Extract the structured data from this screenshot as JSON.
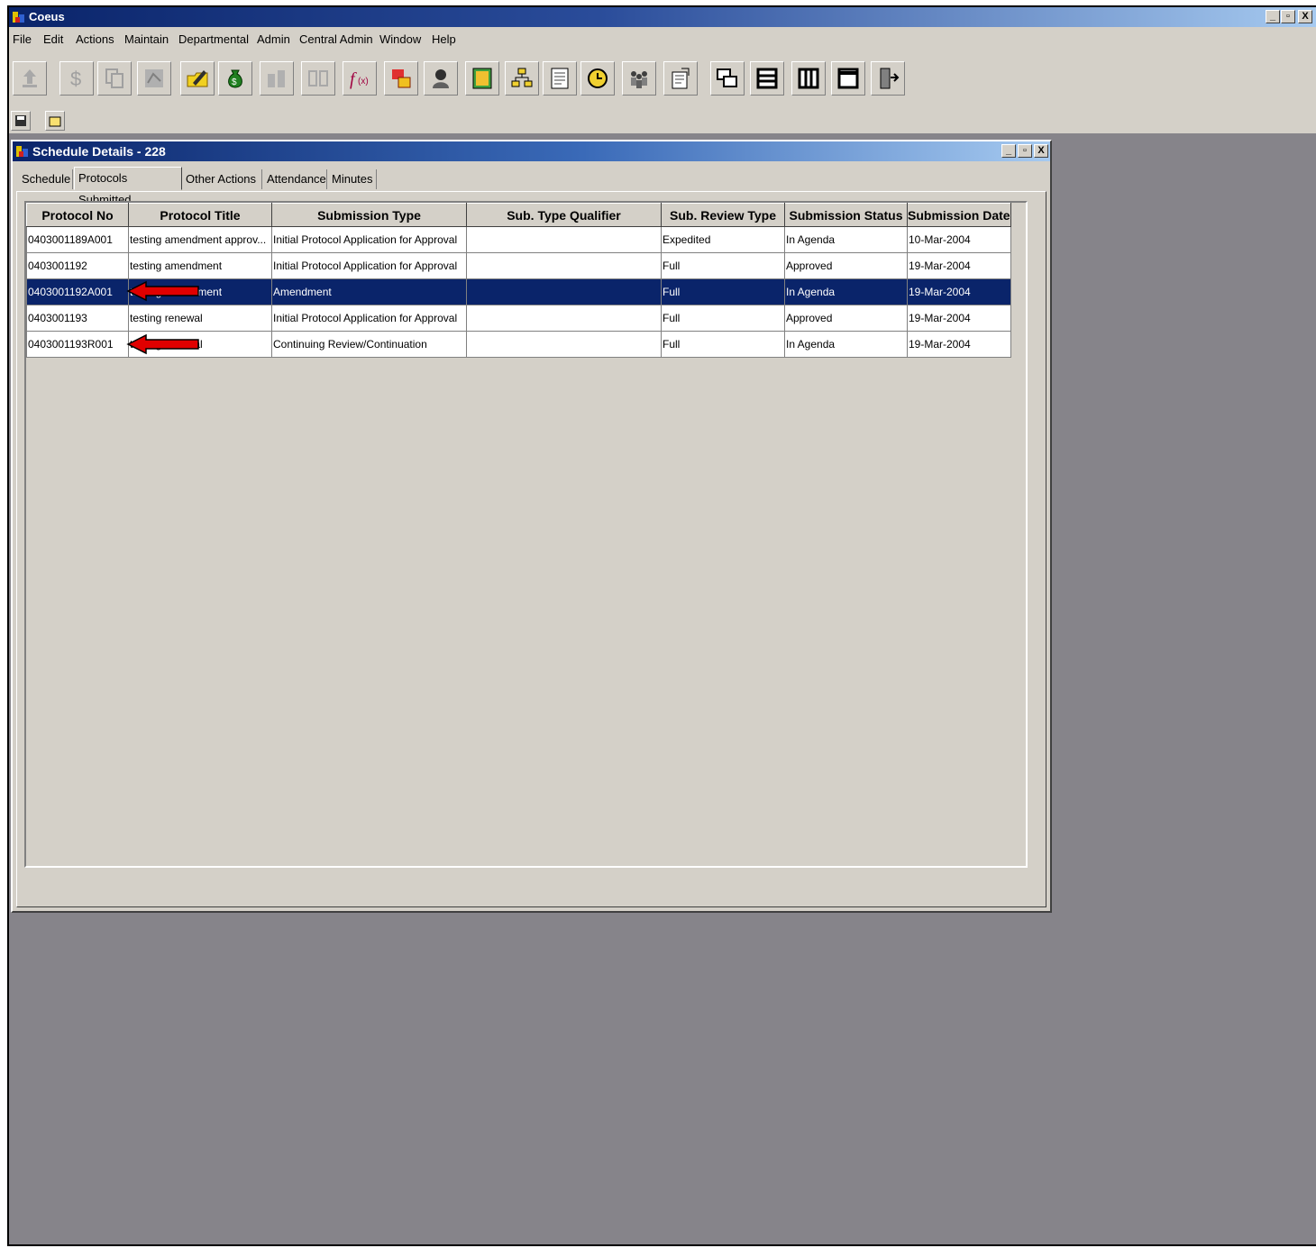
{
  "app": {
    "title": "Coeus"
  },
  "menu": [
    "File",
    "Edit",
    "Actions",
    "Maintain",
    "Departmental",
    "Admin",
    "Central Admin",
    "Window",
    "Help"
  ],
  "window_controls": {
    "minimize": "_",
    "restore": "▫",
    "close": "X"
  },
  "toolbar_icons": [
    "upload-icon",
    "dollar-icon",
    "copy-document-icon",
    "tree-icon",
    "edit-folder-icon",
    "money-bag-icon",
    "people-icon",
    "grid-icon",
    "function-icon",
    "swap-icon",
    "inspector-icon",
    "calculator-icon",
    "hierarchy-icon",
    "notepad-icon",
    "clock-icon",
    "group-icon",
    "report-icon",
    "cascade-windows-icon",
    "tile-horizontal-icon",
    "tile-vertical-icon",
    "maximize-window-icon",
    "exit-icon"
  ],
  "toolbar2_icons": [
    "save-icon",
    "open-icon"
  ],
  "child_window": {
    "title": "Schedule Details - 228",
    "tabs": [
      "Schedule",
      "Protocols Submitted",
      "Other Actions",
      "Attendance",
      "Minutes"
    ],
    "active_tab": "Protocols Submitted"
  },
  "table": {
    "columns": [
      "Protocol No",
      "Protocol Title",
      "Submission Type",
      "Sub. Type Qualifier",
      "Sub. Review Type",
      "Submission Status",
      "Submission Date"
    ],
    "rows": [
      [
        "0403001189A001",
        "testing amendment approv...",
        "Initial Protocol Application for Approval",
        "",
        "Expedited",
        "In Agenda",
        "10-Mar-2004"
      ],
      [
        "0403001192",
        "testing amendment",
        "Initial Protocol Application for Approval",
        "",
        "Full",
        "Approved",
        "19-Mar-2004"
      ],
      [
        "0403001192A001",
        "testing amendment",
        "Amendment",
        "",
        "Full",
        "In Agenda",
        "19-Mar-2004"
      ],
      [
        "0403001193",
        "testing renewal",
        "Initial Protocol Application for Approval",
        "",
        "Full",
        "Approved",
        "19-Mar-2004"
      ],
      [
        "0403001193R001",
        "testing renewal",
        "Continuing Review/Continuation",
        "",
        "Full",
        "In Agenda",
        "19-Mar-2004"
      ]
    ],
    "selected_row": 2
  },
  "annotations": [
    "red-arrow-icon",
    "red-arrow-icon"
  ],
  "colors": {
    "title_bar": "#0a246a",
    "selection": "#0a246a",
    "face": "#d4d0c8",
    "desktop": "#86848a",
    "annotation_arrow": "#e00000"
  }
}
